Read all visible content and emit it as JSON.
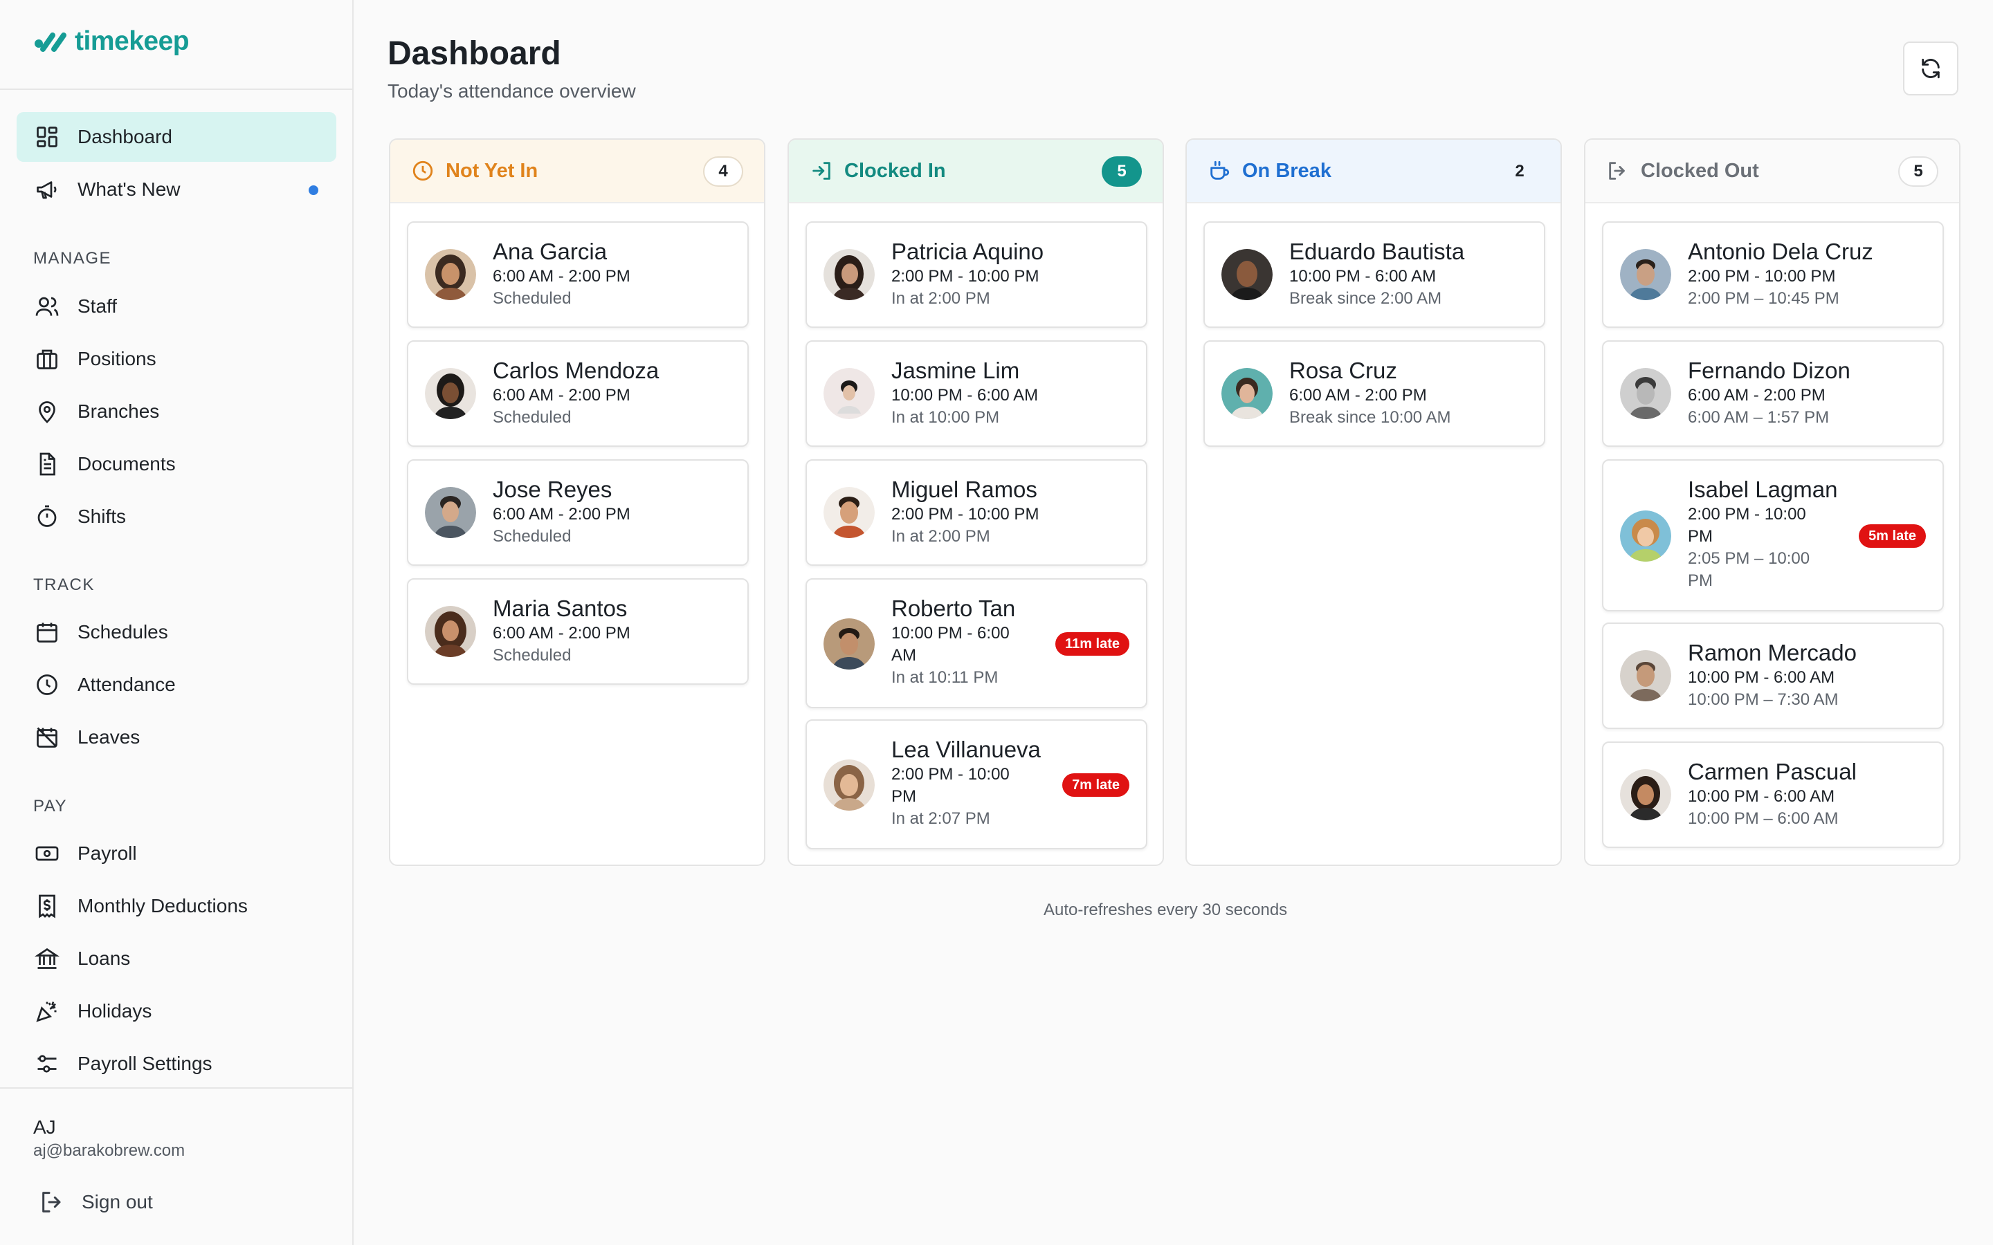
{
  "app": {
    "name": "timekeep",
    "brand_color": "#169c95"
  },
  "sidebar": {
    "top_items": [
      {
        "label": "Dashboard",
        "icon": "layout-grid-icon",
        "active": true
      },
      {
        "label": "What's New",
        "icon": "megaphone-icon",
        "has_dot": true
      }
    ],
    "sections": [
      {
        "label": "MANAGE",
        "items": [
          {
            "label": "Staff",
            "icon": "users-icon"
          },
          {
            "label": "Positions",
            "icon": "briefcase-icon"
          },
          {
            "label": "Branches",
            "icon": "map-pin-icon"
          },
          {
            "label": "Documents",
            "icon": "document-icon"
          },
          {
            "label": "Shifts",
            "icon": "stopwatch-icon"
          }
        ]
      },
      {
        "label": "TRACK",
        "items": [
          {
            "label": "Schedules",
            "icon": "calendar-icon"
          },
          {
            "label": "Attendance",
            "icon": "clock-icon"
          },
          {
            "label": "Leaves",
            "icon": "calendar-off-icon"
          }
        ]
      },
      {
        "label": "PAY",
        "items": [
          {
            "label": "Payroll",
            "icon": "banknote-icon"
          },
          {
            "label": "Monthly Deductions",
            "icon": "receipt-dollar-icon"
          },
          {
            "label": "Loans",
            "icon": "bank-icon"
          },
          {
            "label": "Holidays",
            "icon": "party-popper-icon"
          },
          {
            "label": "Payroll Settings",
            "icon": "settings-sliders-icon"
          }
        ]
      }
    ],
    "user": {
      "initials": "AJ",
      "email": "aj@barakobrew.com"
    },
    "sign_out_label": "Sign out"
  },
  "header": {
    "title": "Dashboard",
    "subtitle": "Today's attendance overview",
    "refresh_icon": "refresh-icon"
  },
  "columns": [
    {
      "key": "not-yet-in",
      "title": "Not Yet In",
      "count": "4",
      "icon": "clock-icon",
      "accent": "#e0831c",
      "cards": [
        {
          "name": "Ana Garcia",
          "shift": "6:00 AM - 2:00 PM",
          "status": "Scheduled"
        },
        {
          "name": "Carlos Mendoza",
          "shift": "6:00 AM - 2:00 PM",
          "status": "Scheduled"
        },
        {
          "name": "Jose Reyes",
          "shift": "6:00 AM - 2:00 PM",
          "status": "Scheduled"
        },
        {
          "name": "Maria Santos",
          "shift": "6:00 AM - 2:00 PM",
          "status": "Scheduled"
        }
      ]
    },
    {
      "key": "clocked-in",
      "title": "Clocked In",
      "count": "5",
      "icon": "log-in-icon",
      "accent": "#138a80",
      "cards": [
        {
          "name": "Patricia Aquino",
          "shift": "2:00 PM - 10:00 PM",
          "status": "In at 2:00 PM"
        },
        {
          "name": "Jasmine Lim",
          "shift": "10:00 PM - 6:00 AM",
          "status": "In at 10:00 PM"
        },
        {
          "name": "Miguel Ramos",
          "shift": "2:00 PM - 10:00 PM",
          "status": "In at 2:00 PM"
        },
        {
          "name": "Roberto Tan",
          "shift": [
            "10:00 PM - 6:00",
            "AM"
          ],
          "status": "In at 10:11 PM",
          "late": "11m late"
        },
        {
          "name": "Lea Villanueva",
          "shift": [
            "2:00 PM - 10:00",
            "PM"
          ],
          "status": "In at 2:07 PM",
          "late": "7m late"
        }
      ]
    },
    {
      "key": "on-break",
      "title": "On Break",
      "count": "2",
      "icon": "coffee-icon",
      "accent": "#1f6fd1",
      "cards": [
        {
          "name": "Eduardo Bautista",
          "shift": "10:00 PM - 6:00 AM",
          "status": "Break since 2:00 AM"
        },
        {
          "name": "Rosa Cruz",
          "shift": "6:00 AM - 2:00 PM",
          "status": "Break since 10:00 AM"
        }
      ]
    },
    {
      "key": "clocked-out",
      "title": "Clocked Out",
      "count": "5",
      "icon": "log-out-icon",
      "accent": "#6b7077",
      "cards": [
        {
          "name": "Antonio Dela Cruz",
          "shift": "2:00 PM - 10:00 PM",
          "status": "2:00 PM – 10:45 PM"
        },
        {
          "name": "Fernando Dizon",
          "shift": "6:00 AM - 2:00 PM",
          "status": "6:00 AM – 1:57 PM"
        },
        {
          "name": "Isabel Lagman",
          "shift": [
            "2:00 PM - 10:00",
            "PM"
          ],
          "status": [
            "2:05 PM – 10:00",
            "PM"
          ],
          "late": "5m late"
        },
        {
          "name": "Ramon Mercado",
          "shift": "10:00 PM - 6:00 AM",
          "status": "10:00 PM – 7:30 AM"
        },
        {
          "name": "Carmen Pascual",
          "shift": "10:00 PM - 6:00 AM",
          "status": "10:00 PM – 6:00 AM"
        }
      ]
    }
  ],
  "footer_note": "Auto-refreshes every 30 seconds",
  "colors": {
    "late_badge": "#e01212",
    "active_nav": "#d7f4f1",
    "notification_dot": "#2f7de1"
  }
}
